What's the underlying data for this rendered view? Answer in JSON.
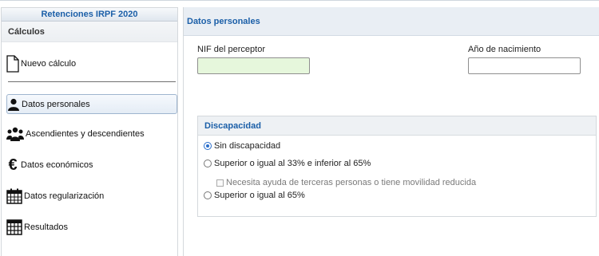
{
  "sidebar": {
    "title": "Retenciones IRPF 2020",
    "section": "Cálculos",
    "new_calc": "Nuevo cálculo",
    "items": [
      {
        "label": "Datos personales",
        "icon": "person-icon",
        "active": true
      },
      {
        "label": "Ascendientes y descendientes",
        "icon": "group-icon"
      },
      {
        "label": "Datos económicos",
        "icon": "euro-icon"
      },
      {
        "label": "Datos regularización",
        "icon": "calendar-icon"
      },
      {
        "label": "Resultados",
        "icon": "calculator-icon"
      }
    ]
  },
  "main": {
    "header": "Datos personales",
    "nif_label": "NIF del perceptor",
    "nif_value": "",
    "birth_label": "Año de nacimiento",
    "birth_value": ""
  },
  "disability": {
    "title": "Discapacidad",
    "opt_none": "Sin discapacidad",
    "opt_33_65": "Superior o igual al 33% e inferior al 65%",
    "help_checkbox": "Necesita ayuda de terceras personas o tiene movilidad reducida",
    "opt_65": "Superior o igual al 65%",
    "selected": "Sin discapacidad"
  },
  "colors": {
    "accent": "#1b5fa8",
    "nif_bg": "#e6f7dc"
  }
}
